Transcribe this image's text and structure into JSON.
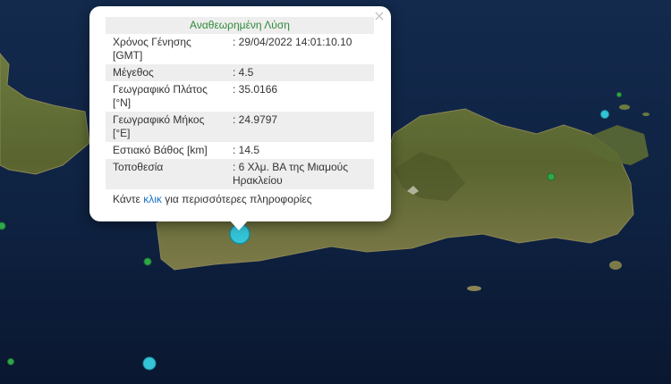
{
  "popup": {
    "title": "Αναθεωρημένη Λύση",
    "close_label": "×",
    "rows": [
      {
        "label": "Χρόνος Γένησης [GMT]",
        "value": ": 29/04/2022 14:01:10.10"
      },
      {
        "label": "Μέγεθος",
        "value": ": 4.5"
      },
      {
        "label": "Γεωγραφικό Πλάτος [°N]",
        "value": ": 35.0166"
      },
      {
        "label": "Γεωγραφικό Μήκος [°E]",
        "value": ": 24.9797"
      },
      {
        "label": "Εστιακό Βάθος [km]",
        "value": ": 14.5"
      },
      {
        "label": "Τοποθεσία",
        "value": ": 6 Χλμ. ΒΑ της Μιαμούς Ηρακλείου"
      }
    ],
    "footer": {
      "before": "Κάντε ",
      "link": "κλικ",
      "after": " για περισσότερες πληροφορίες"
    }
  },
  "colors": {
    "sea": "#0f1f3a",
    "land": "#5e6b35",
    "title_green": "#2e8b3a",
    "link_blue": "#1a73c8",
    "marker_cyan": "#33c4d6",
    "marker_green": "#2fa84a"
  },
  "markers": [
    {
      "kind": "selected-event",
      "color": "cyan"
    },
    {
      "kind": "event",
      "color": "cyan"
    },
    {
      "kind": "event",
      "color": "cyan"
    },
    {
      "kind": "event",
      "color": "green"
    },
    {
      "kind": "event",
      "color": "green"
    },
    {
      "kind": "event",
      "color": "green"
    },
    {
      "kind": "event",
      "color": "green"
    },
    {
      "kind": "event",
      "color": "green"
    }
  ]
}
